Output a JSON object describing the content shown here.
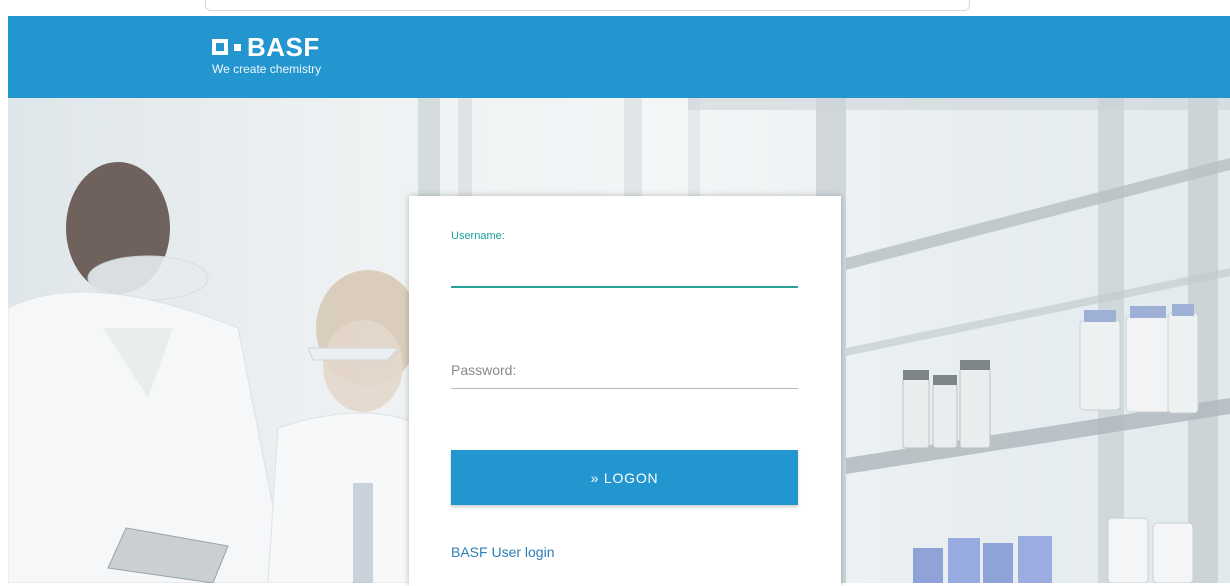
{
  "header": {
    "brand_name": "BASF",
    "tagline": "We create chemistry"
  },
  "form": {
    "username_label": "Username:",
    "username_value": "",
    "password_label": "Password:",
    "password_value": "",
    "logon_label": "» LOGON",
    "user_login_link": "BASF User login"
  },
  "colors": {
    "brand_blue": "#2395cf",
    "accent_teal": "#2aa39c",
    "link_blue": "#2b7fb8"
  }
}
